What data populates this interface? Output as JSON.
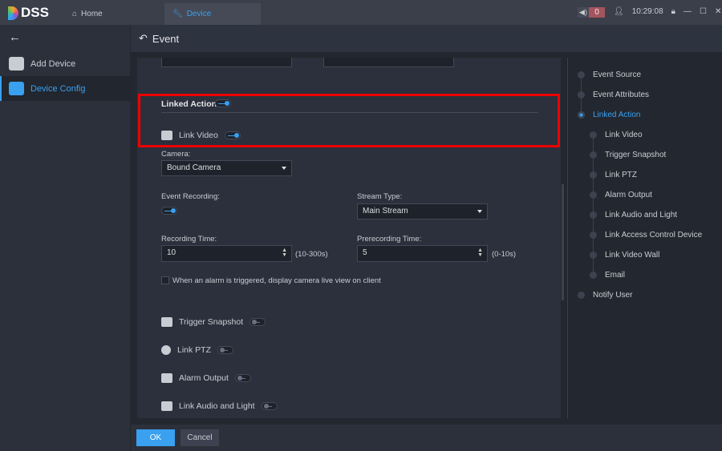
{
  "app": {
    "name": "DSS",
    "tabs": [
      {
        "label": "Home"
      },
      {
        "label": "Device"
      }
    ],
    "alarm_count": "0",
    "time": "10:29:08"
  },
  "sidebar": {
    "items": [
      {
        "label": "Add Device"
      },
      {
        "label": "Device Config"
      }
    ]
  },
  "header": {
    "title": "Event"
  },
  "form": {
    "section_title": "Linked Action",
    "section_enabled": true,
    "link_video": {
      "label": "Link Video",
      "enabled": true
    },
    "camera": {
      "label": "Camera:",
      "value": "Bound Camera"
    },
    "event_recording": {
      "label": "Event Recording:",
      "enabled": true
    },
    "stream_type": {
      "label": "Stream Type:",
      "value": "Main Stream"
    },
    "recording_time": {
      "label": "Recording Time:",
      "value": "10",
      "range": "(10-300s)"
    },
    "prerecording_time": {
      "label": "Prerecording Time:",
      "value": "5",
      "range": "(0-10s)"
    },
    "live_view_checkbox": {
      "label": "When an alarm is triggered, display camera live view on client",
      "checked": false
    },
    "actions": [
      {
        "label": "Trigger Snapshot",
        "enabled": false
      },
      {
        "label": "Link PTZ",
        "enabled": false
      },
      {
        "label": "Alarm Output",
        "enabled": false
      },
      {
        "label": "Link Audio and Light",
        "enabled": false
      }
    ]
  },
  "nav": {
    "items": [
      {
        "label": "Event Source"
      },
      {
        "label": "Event Attributes"
      },
      {
        "label": "Linked Action"
      }
    ],
    "subitems": [
      {
        "label": "Link Video"
      },
      {
        "label": "Trigger Snapshot"
      },
      {
        "label": "Link PTZ"
      },
      {
        "label": "Alarm Output"
      },
      {
        "label": "Link Audio and Light"
      },
      {
        "label": "Link Access Control Device"
      },
      {
        "label": "Link Video Wall"
      },
      {
        "label": "Email"
      }
    ],
    "last": {
      "label": "Notify User"
    }
  },
  "footer": {
    "ok": "OK",
    "cancel": "Cancel"
  },
  "colors": {
    "accent": "#3aa0f0",
    "highlight": "#ee0000"
  }
}
